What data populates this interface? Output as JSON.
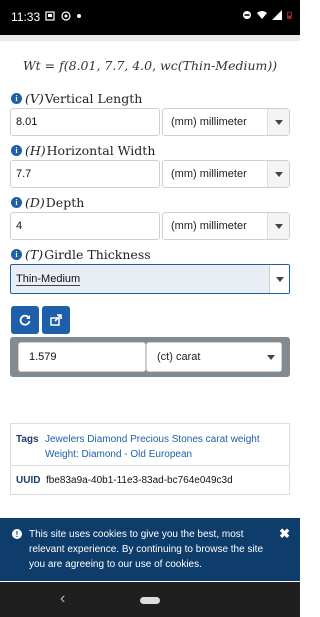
{
  "status_bar": {
    "time": "11:33"
  },
  "formula": "Wt = f(8.01, 7.7, 4.0, wc(Thin-Medium))",
  "fields": [
    {
      "var": "(V)",
      "label": "Vertical Length",
      "value": "8.01",
      "unit": "(mm) millimeter"
    },
    {
      "var": "(H)",
      "label": "Horizontal Width",
      "value": "7.7",
      "unit": "(mm) millimeter"
    },
    {
      "var": "(D)",
      "label": "Depth",
      "value": "4",
      "unit": "(mm) millimeter"
    }
  ],
  "girdle": {
    "var": "(T)",
    "label": "Girdle Thickness",
    "selected": "Thin-Medium"
  },
  "result": {
    "value": "1.579",
    "unit": "(ct) carat"
  },
  "tags": {
    "key": "Tags",
    "items": [
      "Jewelers",
      "Diamond",
      "Precious Stones",
      "carat",
      "weight",
      "Weight: Diamond - Old European"
    ]
  },
  "uuid": {
    "key": "UUID",
    "value": "fbe83a9a-40b1-11e3-83ad-bc764e049c3d"
  },
  "cookie": {
    "text": "This site uses cookies to give you the best, most relevant experience. By continuing to browse the site you are agreeing to our use of cookies.",
    "close": "✖"
  },
  "icons": {
    "info": "info-icon",
    "refresh": "refresh-icon",
    "share": "share-icon"
  },
  "colors": {
    "accent": "#1d5fa8",
    "banner": "#0e3d6c",
    "result_panel": "#828a92"
  }
}
